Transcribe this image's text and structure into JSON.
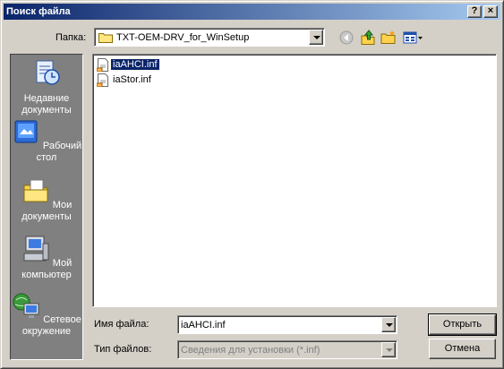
{
  "window": {
    "title": "Поиск файла",
    "help_glyph": "?",
    "close_glyph": "×"
  },
  "toolbar": {
    "lookin_label": "Папка:",
    "lookin_value": "TXT-OEM-DRV_for_WinSetup",
    "icons": [
      "back-icon",
      "up-folder-icon",
      "new-folder-icon",
      "view-menu-icon"
    ]
  },
  "places": [
    {
      "label": "Недавние документы",
      "icon": "recent-documents-icon"
    },
    {
      "label": "Рабочий стол",
      "icon": "desktop-icon"
    },
    {
      "label": "Мои документы",
      "icon": "my-documents-icon"
    },
    {
      "label": "Мой компьютер",
      "icon": "my-computer-icon"
    },
    {
      "label": "Сетевое окружение",
      "icon": "network-icon"
    }
  ],
  "files": [
    {
      "name": "iaAHCI.inf",
      "selected": true
    },
    {
      "name": "iaStor.inf",
      "selected": false
    }
  ],
  "form": {
    "filename_label": "Имя файла:",
    "filename_value": "iaAHCI.inf",
    "filetype_label": "Тип файлов:",
    "filetype_value": "Сведения для установки (*.inf)"
  },
  "buttons": {
    "open": "Открыть",
    "cancel": "Отмена"
  },
  "colors": {
    "titlebar_start": "#0a246a",
    "titlebar_end": "#a6caf0",
    "face": "#d4d0c8",
    "places_bg": "#808080"
  }
}
